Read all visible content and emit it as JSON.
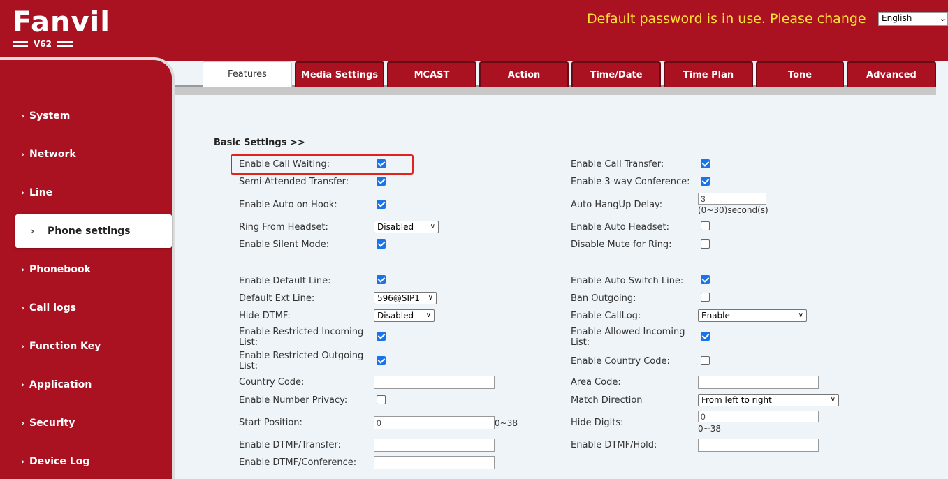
{
  "header": {
    "brand": "Fanvil",
    "model": "V62",
    "warning": "Default password is in use. Please change",
    "language": "English"
  },
  "sidebar": {
    "items": [
      {
        "label": "System"
      },
      {
        "label": "Network"
      },
      {
        "label": "Line"
      },
      {
        "label": "Phone settings",
        "active": true
      },
      {
        "label": "Phonebook"
      },
      {
        "label": "Call logs"
      },
      {
        "label": "Function Key"
      },
      {
        "label": "Application"
      },
      {
        "label": "Security"
      },
      {
        "label": "Device Log"
      }
    ]
  },
  "tabs": [
    {
      "label": "Features",
      "active": true
    },
    {
      "label": "Media Settings"
    },
    {
      "label": "MCAST"
    },
    {
      "label": "Action"
    },
    {
      "label": "Time/Date"
    },
    {
      "label": "Time Plan"
    },
    {
      "label": "Tone"
    },
    {
      "label": "Advanced"
    }
  ],
  "main": {
    "section_title": "Basic Settings >>",
    "left": {
      "call_waiting": {
        "label": "Enable Call Waiting:",
        "checked": true
      },
      "semi_attended": {
        "label": "Semi-Attended Transfer:",
        "checked": true
      },
      "auto_on_hook": {
        "label": "Enable Auto on Hook:",
        "checked": true
      },
      "ring_headset": {
        "label": "Ring From Headset:",
        "value": "Disabled"
      },
      "silent_mode": {
        "label": "Enable Silent Mode:",
        "checked": true
      },
      "default_line": {
        "label": "Enable Default Line:",
        "checked": true
      },
      "default_ext_line": {
        "label": "Default Ext Line:",
        "value": "596@SIP1"
      },
      "hide_dtmf": {
        "label": "Hide DTMF:",
        "value": "Disabled"
      },
      "restricted_incoming": {
        "label_line1": "Enable Restricted Incoming",
        "label_line2": "List:",
        "checked": true
      },
      "restricted_outgoing": {
        "label_line1": "Enable Restricted Outgoing",
        "label_line2": "List:",
        "checked": true
      },
      "country_code": {
        "label": "Country Code:",
        "value": ""
      },
      "number_privacy": {
        "label": "Enable Number Privacy:",
        "checked": false
      },
      "start_position": {
        "label": "Start Position:",
        "value": "0",
        "hint": "0~38"
      },
      "dtmf_transfer": {
        "label": "Enable DTMF/Transfer:",
        "value": ""
      },
      "dtmf_conference": {
        "label": "Enable DTMF/Conference:",
        "value": ""
      }
    },
    "right": {
      "call_transfer": {
        "label": "Enable Call Transfer:",
        "checked": true
      },
      "three_way": {
        "label": "Enable 3-way Conference:",
        "checked": true
      },
      "auto_hangup": {
        "label": "Auto HangUp Delay:",
        "value": "3",
        "hint": "(0~30)second(s)"
      },
      "auto_headset": {
        "label": "Enable Auto Headset:",
        "checked": false
      },
      "disable_mute_ring": {
        "label": "Disable Mute for Ring:",
        "checked": false
      },
      "auto_switch_line": {
        "label": "Enable Auto Switch Line:",
        "checked": true
      },
      "ban_outgoing": {
        "label": "Ban Outgoing:",
        "checked": false
      },
      "call_log": {
        "label": "Enable CallLog:",
        "value": "Enable"
      },
      "allowed_incoming": {
        "label_line1": "Enable Allowed Incoming",
        "label_line2": "List:",
        "checked": true
      },
      "country_code_enable": {
        "label": "Enable Country Code:",
        "checked": false
      },
      "area_code": {
        "label": "Area Code:",
        "value": ""
      },
      "match_direction": {
        "label": "Match Direction",
        "value": "From left to right"
      },
      "hide_digits": {
        "label": "Hide Digits:",
        "value": "0",
        "hint": "0~38"
      },
      "dtmf_hold": {
        "label": "Enable DTMF/Hold:",
        "value": ""
      }
    }
  }
}
